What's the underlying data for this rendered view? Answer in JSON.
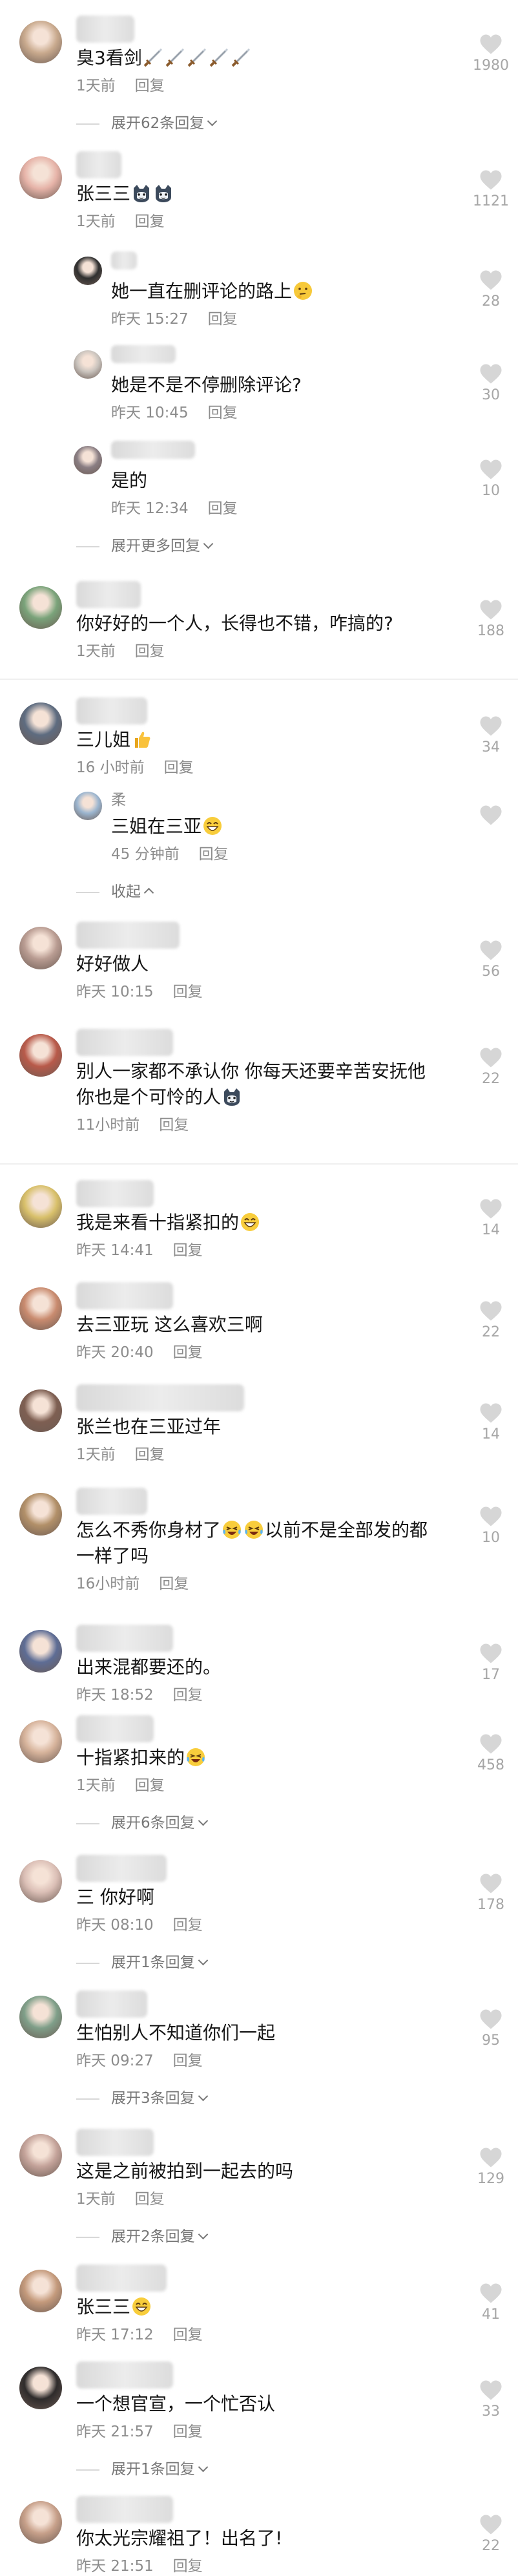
{
  "comments": [
    {
      "text": "臭3看剑",
      "emoji": [
        "sword",
        "sword",
        "sword",
        "sword",
        "sword"
      ],
      "time": "1天前",
      "reply": "回复",
      "likes": "1980",
      "expand": "展开62条回复"
    },
    {
      "text": "张三三",
      "emoji": [
        "cat",
        "cat"
      ],
      "time": "1天前",
      "reply": "回复",
      "likes": "1121"
    },
    {
      "text": "她一直在删评论的路上",
      "emoji": [
        "think"
      ],
      "time": "昨天 15:27",
      "reply": "回复",
      "likes": "28"
    },
    {
      "text": "她是不是不停删除评论?",
      "time": "昨天 10:45",
      "reply": "回复",
      "likes": "30"
    },
    {
      "text": "是的",
      "time": "昨天 12:34",
      "reply": "回复",
      "likes": "10",
      "expand": "展开更多回复"
    },
    {
      "text": "你好好的一个人，长得也不错，咋搞的?",
      "time": "1天前",
      "reply": "回复",
      "likes": "188"
    },
    {
      "text": "三儿姐",
      "emoji": [
        "thumb"
      ],
      "time": "16 小时前",
      "reply": "回复",
      "likes": "34"
    },
    {
      "name": "柔",
      "text": "三姐在三亚",
      "emoji": [
        "grin"
      ],
      "time": "45 分钟前",
      "reply": "回复",
      "expand": "收起"
    },
    {
      "text": "好好做人",
      "time": "昨天 10:15",
      "reply": "回复",
      "likes": "56"
    },
    {
      "text": "别人一家都不承认你 你每天还要辛苦安抚他\n你也是个可怜的人",
      "emoji": [
        "cat"
      ],
      "time": "11小时前",
      "reply": "回复",
      "likes": "22"
    },
    {
      "text": "我是来看十指紧扣的",
      "emoji": [
        "grin"
      ],
      "time": "昨天 14:41",
      "reply": "回复",
      "likes": "14"
    },
    {
      "text": "去三亚玩 这么喜欢三啊",
      "time": "昨天 20:40",
      "reply": "回复",
      "likes": "22"
    },
    {
      "text": "张兰也在三亚过年",
      "time": "1天前",
      "reply": "回复",
      "likes": "14"
    },
    {
      "text": "怎么不秀你身材了",
      "emoji": [
        "lol",
        "lol"
      ],
      "text2": "以前不是全部发的都\n一样了吗",
      "time": "16小时前",
      "reply": "回复",
      "likes": "10"
    },
    {
      "text": "出来混都要还的。",
      "time": "昨天 18:52",
      "reply": "回复",
      "likes": "17"
    },
    {
      "text": "十指紧扣来的",
      "emoji": [
        "lol"
      ],
      "time": "1天前",
      "reply": "回复",
      "likes": "458",
      "expand": "展开6条回复"
    },
    {
      "text": "三 你好啊",
      "time": "昨天 08:10",
      "reply": "回复",
      "likes": "178",
      "expand": "展开1条回复"
    },
    {
      "text": "生怕别人不知道你们一起",
      "time": "昨天 09:27",
      "reply": "回复",
      "likes": "95",
      "expand": "展开3条回复"
    },
    {
      "text": "这是之前被拍到一起去的吗",
      "time": "1天前",
      "reply": "回复",
      "likes": "129",
      "expand": "展开2条回复"
    },
    {
      "text": "张三三",
      "emoji": [
        "grin"
      ],
      "time": "昨天 17:12",
      "reply": "回复",
      "likes": "41"
    },
    {
      "text": "一个想官宣，一个忙否认",
      "time": "昨天 21:57",
      "reply": "回复",
      "likes": "33",
      "expand": "展开1条回复"
    },
    {
      "text": "你太光宗耀祖了！出名了!",
      "time": "昨天 21:51",
      "reply": "回复",
      "likes": "22"
    }
  ],
  "icons": {
    "like": "heart-outline-icon",
    "expand": "chevron-down-icon",
    "collapse": "chevron-up-icon"
  },
  "colors": {
    "text": "#161616",
    "meta": "#8c8c8c",
    "like": "#d0d0d0",
    "background": "#ffffff"
  }
}
